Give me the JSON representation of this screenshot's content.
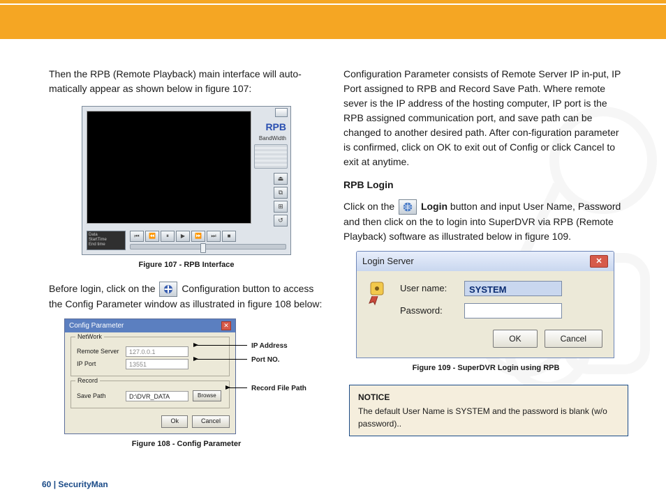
{
  "header": {},
  "left": {
    "intro": "Then the RPB (Remote Playback) main interface will auto-matically appear as shown below in figure 107:",
    "fig107_caption": "Figure 107 - RPB Interface",
    "rpb": {
      "label": "RPB",
      "bandwidth": "BandWidth",
      "readout_lines": [
        "Data",
        "StartTime",
        "End time"
      ],
      "transport": [
        "⏮",
        "⏪",
        "⏸",
        "▶",
        "⏩",
        "⏭",
        "■"
      ],
      "side_btns": [
        "⏏",
        "⧉",
        "⊞",
        "↺"
      ]
    },
    "before_login": [
      "Before login, click on the",
      "Configuration button to access the Config Parameter window as illustrated in figure 108 below:"
    ],
    "config_icon_glyph": "⚙",
    "cfg": {
      "title": "Config Parameter",
      "group1": "NetWork",
      "remote_server_label": "Remote Server",
      "remote_server_value": "127.0.0.1",
      "ip_port_label": "IP Port",
      "ip_port_value": "13551",
      "group2": "Record",
      "save_path_label": "Save Path",
      "save_path_value": "D:\\DVR_DATA",
      "browse": "Browse",
      "ok": "Ok",
      "cancel": "Cancel",
      "callout_ip": "IP Address",
      "callout_port": "Port NO.",
      "callout_path": "Record File Path"
    },
    "fig108_caption": "Figure 108 - Config Parameter"
  },
  "right": {
    "para1": "Configuration Parameter consists of Remote Server IP in-put, IP Port assigned to RPB and Record Save Path.  Where remote sever is the IP address of the hosting computer, IP port is the RPB assigned communication port, and save path can be changed to another desired path.  After con-figuration parameter is confirmed, click on OK to exit out of Config or click Cancel to exit at anytime.",
    "rpb_login_head": "RPB Login",
    "login_sentence_pre": "Click on the",
    "login_sentence_strong": "Login",
    "login_sentence_post": " button and input User Name, Password and then click on the to login into SuperDVR via RPB (Remote Playback) software as illustrated below in figure 109.",
    "login_icon_glyph": "🌐",
    "login": {
      "title": "Login Server",
      "user_label": "User name:",
      "user_value": "SYSTEM",
      "pass_label": "Password:",
      "ok": "OK",
      "cancel": "Cancel"
    },
    "fig109_caption": "Figure 109 - SuperDVR Login using RPB",
    "notice_head": "NOTICE",
    "notice_body": "The default User Name is SYSTEM and the password is blank (w/o password).."
  },
  "footer": {
    "page": "60",
    "sep": "  |  ",
    "brand": "SecurityMan"
  }
}
